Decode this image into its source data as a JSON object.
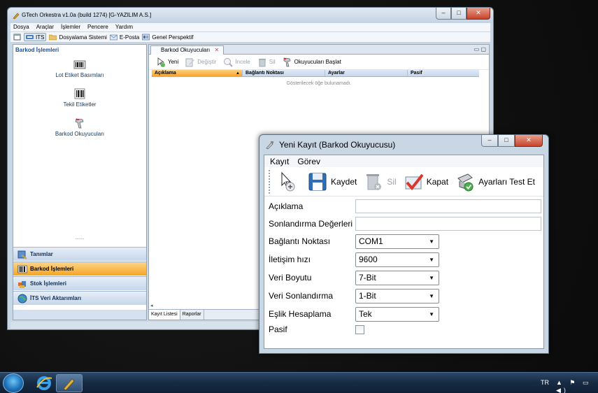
{
  "main_window": {
    "title": "GTech Orkestra v1.0a (build 1274) [G-YAZILIM A.S.]",
    "caption_buttons": [
      "–",
      "□",
      "✕"
    ],
    "menu": [
      "Dosya",
      "Araçlar",
      "İşlemler",
      "Pencere",
      "Yardım"
    ],
    "toolbar": [
      {
        "label": "ITS",
        "icon": "its-icon",
        "active": true
      },
      {
        "label": "Dosyalama Sistemi",
        "icon": "folder-icon"
      },
      {
        "label": "E-Posta",
        "icon": "mail-icon"
      },
      {
        "label": "Genel Perspektif",
        "icon": "perspective-icon"
      }
    ]
  },
  "left_panel": {
    "header": "Barkod İşlemleri",
    "tools": [
      "Lot Etiket Basımları",
      "Tekil Etiketler",
      "Barkod Okuyucuları"
    ],
    "splitter": "........",
    "nav": [
      "Tanımlar",
      "Barkod İşlemleri",
      "Stok İşlemleri",
      "İTS Veri Aktarımları"
    ]
  },
  "main_view": {
    "tab_label": "Barkod Okuyucuları",
    "tab_close": "✕",
    "view_controls": "▭ ▢",
    "toolbar": {
      "new": "Yeni",
      "edit": "Değiştir",
      "inspect": "İncele",
      "delete": "Sil",
      "start": "Okuyucuları Başlat"
    },
    "columns": [
      "Açıklama",
      "Bağlantı Noktası",
      "Ayarlar",
      "Pasif"
    ],
    "sort_arrow": "▲",
    "empty_text": "Gösterilecek öğe bulunamadı.",
    "hscroll_arrow": "◂",
    "bottom_tabs": [
      "Kayıt Listesi",
      "Raporlar"
    ]
  },
  "dialog": {
    "title": "Yeni Kayıt (Barkod Okuyucusu)",
    "caption_buttons": [
      "–",
      "□",
      "✕"
    ],
    "menu": [
      "Kayıt",
      "Görev"
    ],
    "toolbar": {
      "save": "Kaydet",
      "delete": "Sil",
      "close": "Kapat",
      "test": "Ayarları Test Et"
    },
    "fields": {
      "aciklama_label": "Açıklama",
      "aciklama_value": "",
      "sonlandirma_degerleri_label": "Sonlandırma Değerleri",
      "sonlandirma_degerleri_value": "",
      "baglanti_noktasi_label": "Bağlantı Noktası",
      "baglanti_noktasi_value": "COM1",
      "iletisim_hizi_label": "İletişim hızı",
      "iletisim_hizi_value": "9600",
      "veri_boyutu_label": "Veri Boyutu",
      "veri_boyutu_value": "7-Bit",
      "veri_sonlandirma_label": "Veri Sonlandırma",
      "veri_sonlandirma_value": "1-Bit",
      "eslik_label": "Eşlik Hesaplama",
      "eslik_value": "Tek",
      "pasif_label": "Pasif",
      "pasif_checked": false
    },
    "combo_arrow": "▼"
  },
  "taskbar": {
    "language": "TR",
    "tray_icons": "▲ ⚑ ▭ ◀)"
  }
}
